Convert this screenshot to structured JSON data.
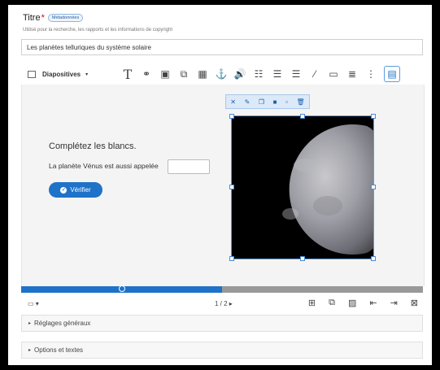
{
  "field": {
    "label": "Titre",
    "required_mark": "*",
    "badge": "Métadonnées",
    "hint": "Utilisé pour la recherche, les rapports et les informations de copyright",
    "value": "Les planètes telluriques du système solaire"
  },
  "toolbar": {
    "slides_label": "Diapositives",
    "buttons": [
      "text",
      "link",
      "image",
      "shape",
      "video",
      "anchor",
      "audio",
      "fill-in",
      "single-choice",
      "multi-choice",
      "true-false",
      "drag-text",
      "summary",
      "more",
      "current"
    ]
  },
  "slide": {
    "heading": "Complétez les blancs.",
    "sentence": "La planète Vénus est aussi appelée",
    "answer_value": "",
    "verify_label": "Vérifier"
  },
  "progress": {
    "fraction": 0.5
  },
  "pager": {
    "text": "1 / 2"
  },
  "sections": {
    "general": "Réglages généraux",
    "options": "Options et textes"
  },
  "colors": {
    "accent": "#1e72c8",
    "required": "#dd0000",
    "planet_bg": "#000000"
  }
}
